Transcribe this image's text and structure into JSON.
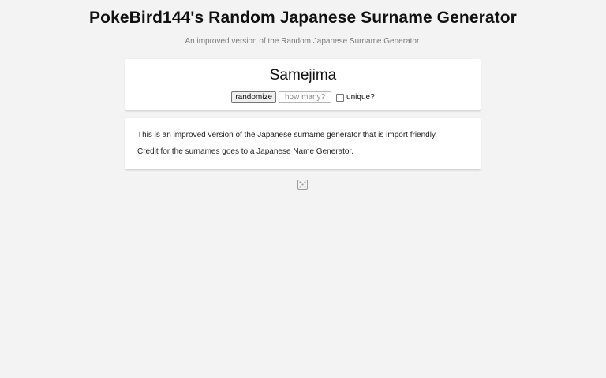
{
  "header": {
    "title": "PokeBird144's Random Japanese Surname Generator",
    "subtitle": "An improved version of the Random Japanese Surname Generator."
  },
  "result": {
    "name": "Samejima"
  },
  "controls": {
    "randomize_label": "randomize",
    "count_placeholder": "how many?",
    "count_value": "",
    "unique_label": "unique?",
    "unique_checked": false
  },
  "info": {
    "line1": "This is an improved version of the Japanese surname generator that is import friendly.",
    "line2": "Credit for the surnames goes to a Japanese Name Generator."
  },
  "footer": {
    "icon": "dice-icon"
  },
  "colors": {
    "background": "#f3f3f3",
    "card": "#ffffff",
    "subtitle_text": "#7a7a7a"
  }
}
